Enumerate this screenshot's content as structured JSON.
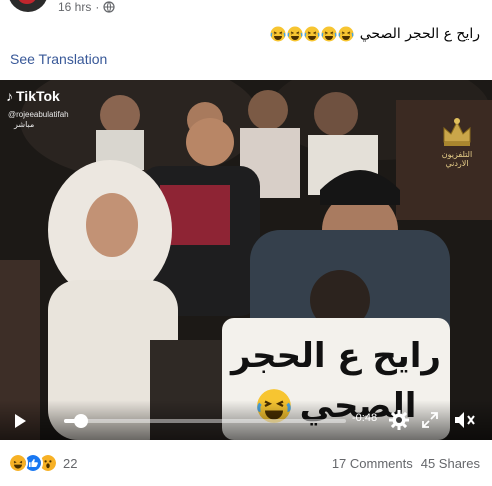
{
  "post": {
    "time": "16 hrs",
    "caption": "رايح ع الحجر الصحي",
    "see_translation": "See Translation"
  },
  "video": {
    "watermark_brand": "TikTok",
    "watermark_handle": "@rojeeabulatifah",
    "watermark_sub": "مباشر",
    "channel_label": "التلفزيون الاردني",
    "overlay_line1": "رايح ع الحجر",
    "overlay_line2": "الصحي",
    "progress": 0.06,
    "time_remaining": "-0:48"
  },
  "footer": {
    "reaction_count": "22",
    "comments": "17 Comments",
    "shares": "45 Shares"
  },
  "colors": {
    "link": "#385898",
    "meta": "#65676b",
    "like": "#1877f2",
    "haha": "#f7b125"
  },
  "icons": {
    "globe": "globe-icon",
    "play": "play-icon",
    "settings": "gear-icon",
    "expand": "expand-icon",
    "mute": "speaker-muted-icon"
  }
}
